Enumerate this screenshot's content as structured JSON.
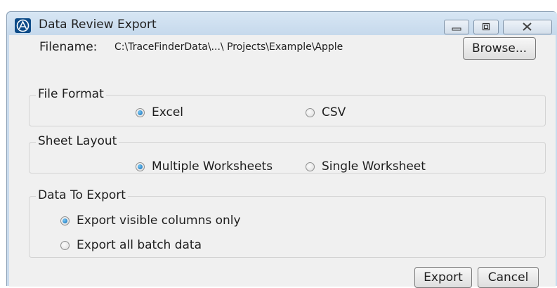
{
  "window": {
    "title": "Data Review Export",
    "icon": "app-logo-icon",
    "controls": {
      "minimize": "minimize-icon",
      "maximize": "maximize-icon",
      "close": "close-icon"
    }
  },
  "filename": {
    "label": "Filename:",
    "value": "C:\\TraceFinderData\\...\\ Projects\\Example\\Apple",
    "browse_label": "Browse..."
  },
  "file_format": {
    "title": "File Format",
    "options": [
      {
        "label": "Excel",
        "checked": true
      },
      {
        "label": "CSV",
        "checked": false
      }
    ]
  },
  "sheet_layout": {
    "title": "Sheet Layout",
    "options": [
      {
        "label": "Multiple Worksheets",
        "checked": true
      },
      {
        "label": "Single Worksheet",
        "checked": false
      }
    ]
  },
  "data_to_export": {
    "title": "Data To Export",
    "options": [
      {
        "label": "Export visible columns only",
        "checked": true
      },
      {
        "label": "Export all batch data",
        "checked": false
      }
    ]
  },
  "footer": {
    "export_label": "Export",
    "cancel_label": "Cancel"
  },
  "colors": {
    "titlebar": "#c9dbed",
    "client": "#f0f0f0",
    "radio_selected": "#1a7cc8",
    "app_icon": "#0d4b88"
  }
}
